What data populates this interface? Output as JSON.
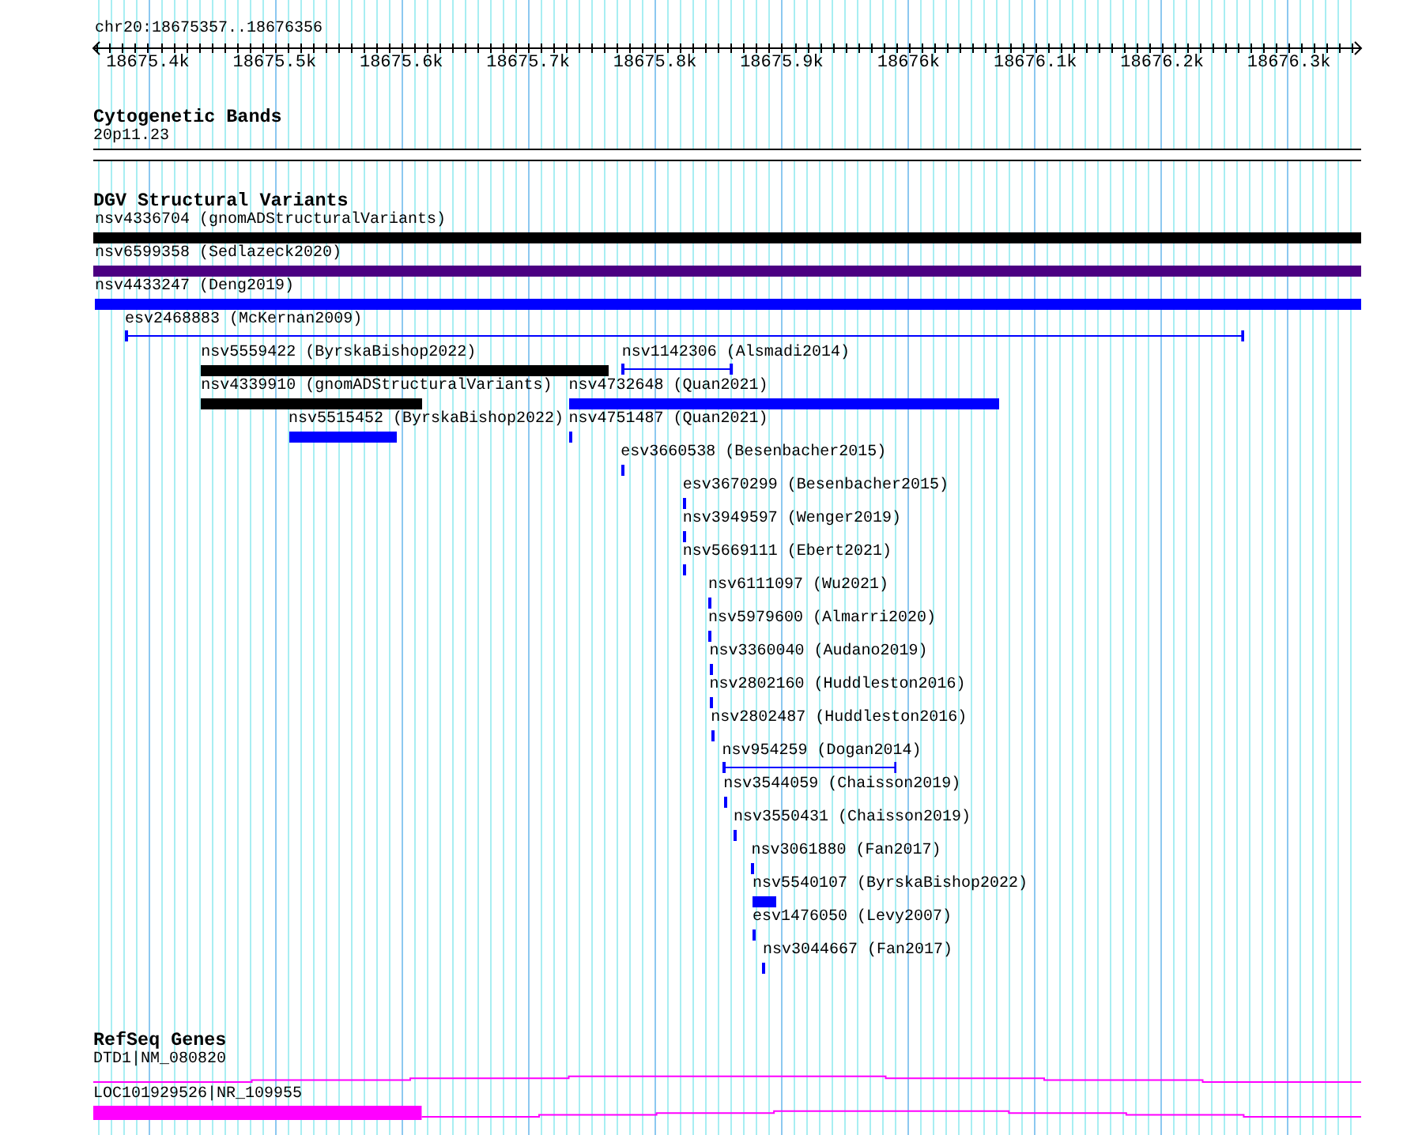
{
  "locus": "chr20:18675357..18676356",
  "ruler": {
    "ticks": [
      {
        "label": "18675.4k"
      },
      {
        "label": "18675.5k"
      },
      {
        "label": "18675.6k"
      },
      {
        "label": "18675.7k"
      },
      {
        "label": "18675.8k"
      },
      {
        "label": "18675.9k"
      },
      {
        "label": "18676k"
      },
      {
        "label": "18676.1k"
      },
      {
        "label": "18676.2k"
      },
      {
        "label": "18676.3k"
      }
    ]
  },
  "cytoband_track": {
    "title": "Cytogenetic Bands",
    "bands": [
      {
        "name": "20p11.23"
      }
    ]
  },
  "variant_track": {
    "title": "DGV Structural Variants",
    "rows": [
      {
        "features": [
          {
            "label": "nsv4336704 (gnomADStructuralVariants)",
            "kind": "bar",
            "color": "#000000"
          }
        ]
      },
      {
        "features": [
          {
            "label": "nsv6599358 (Sedlazeck2020)",
            "kind": "bar",
            "color": "#4b0082"
          }
        ]
      },
      {
        "features": [
          {
            "label": "nsv4433247 (Deng2019)",
            "kind": "bar",
            "color": "#0000ff"
          }
        ]
      },
      {
        "features": [
          {
            "label": "esv2468883 (McKernan2009)",
            "kind": "line",
            "color": "#0000ff"
          }
        ]
      },
      {
        "features": [
          {
            "label": "nsv5559422 (ByrskaBishop2022)",
            "kind": "bar",
            "color": "#000000"
          },
          {
            "label": "nsv1142306 (Alsmadi2014)",
            "kind": "line",
            "color": "#0000ff"
          }
        ]
      },
      {
        "features": [
          {
            "label": "nsv4339910 (gnomADStructuralVariants)",
            "kind": "bar",
            "color": "#000000"
          },
          {
            "label": "nsv4732648 (Quan2021)",
            "kind": "bar",
            "color": "#0000ff"
          }
        ]
      },
      {
        "features": [
          {
            "label": "nsv5515452 (ByrskaBishop2022)",
            "kind": "bar",
            "color": "#0000ff"
          },
          {
            "label": "nsv4751487 (Quan2021)",
            "kind": "bar",
            "color": "#0000ff"
          }
        ]
      },
      {
        "features": [
          {
            "label": "esv3660538 (Besenbacher2015)",
            "kind": "bar",
            "color": "#0000ff"
          }
        ]
      },
      {
        "features": [
          {
            "label": "esv3670299 (Besenbacher2015)",
            "kind": "bar",
            "color": "#0000ff"
          }
        ]
      },
      {
        "features": [
          {
            "label": "nsv3949597 (Wenger2019)",
            "kind": "bar",
            "color": "#0000ff"
          }
        ]
      },
      {
        "features": [
          {
            "label": "nsv5669111 (Ebert2021)",
            "kind": "bar",
            "color": "#0000ff"
          }
        ]
      },
      {
        "features": [
          {
            "label": "nsv6111097 (Wu2021)",
            "kind": "bar",
            "color": "#0000ff"
          }
        ]
      },
      {
        "features": [
          {
            "label": "nsv5979600 (Almarri2020)",
            "kind": "bar",
            "color": "#0000ff"
          }
        ]
      },
      {
        "features": [
          {
            "label": "nsv3360040 (Audano2019)",
            "kind": "bar",
            "color": "#0000ff"
          }
        ]
      },
      {
        "features": [
          {
            "label": "nsv2802160 (Huddleston2016)",
            "kind": "bar",
            "color": "#0000ff"
          }
        ]
      },
      {
        "features": [
          {
            "label": "nsv2802487 (Huddleston2016)",
            "kind": "bar",
            "color": "#0000ff"
          }
        ]
      },
      {
        "features": [
          {
            "label": "nsv954259 (Dogan2014)",
            "kind": "line",
            "color": "#0000ff"
          }
        ]
      },
      {
        "features": [
          {
            "label": "nsv3544059 (Chaisson2019)",
            "kind": "bar",
            "color": "#0000ff"
          }
        ]
      },
      {
        "features": [
          {
            "label": "nsv3550431 (Chaisson2019)",
            "kind": "bar",
            "color": "#0000ff"
          }
        ]
      },
      {
        "features": [
          {
            "label": "nsv3061880 (Fan2017)",
            "kind": "bar",
            "color": "#0000ff"
          }
        ]
      },
      {
        "features": [
          {
            "label": "nsv5540107 (ByrskaBishop2022)",
            "kind": "bar",
            "color": "#0000ff"
          }
        ]
      },
      {
        "features": [
          {
            "label": "esv1476050 (Levy2007)",
            "kind": "bar",
            "color": "#0000ff"
          }
        ]
      },
      {
        "features": [
          {
            "label": "nsv3044667 (Fan2017)",
            "kind": "bar",
            "color": "#0000ff"
          }
        ]
      }
    ]
  },
  "gene_track": {
    "title": "RefSeq Genes",
    "genes": [
      {
        "label": "DTD1|NM_080820"
      },
      {
        "label": "LOC101929526|NR_109955"
      }
    ]
  }
}
